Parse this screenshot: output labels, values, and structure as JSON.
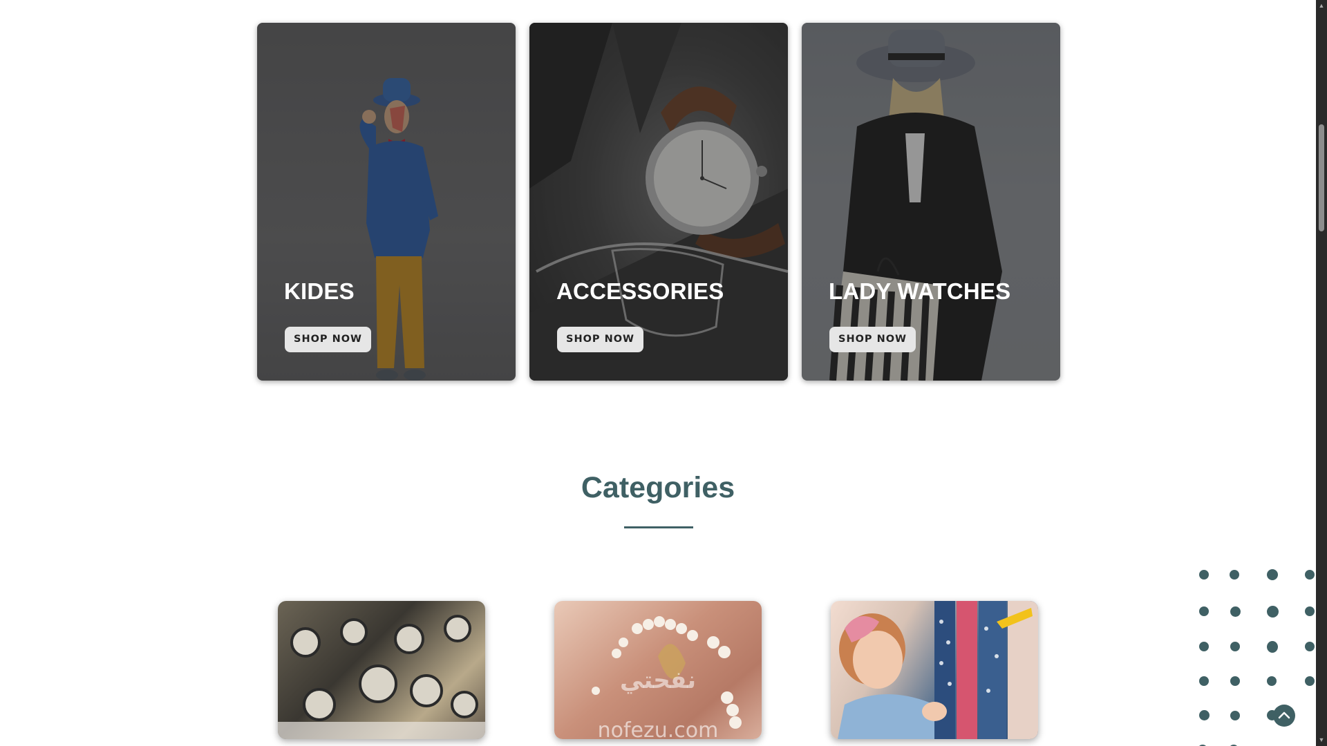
{
  "promo_cards": [
    {
      "title": "KIDES",
      "button": "SHOP NOW"
    },
    {
      "title": "ACCESSORIES",
      "button": "SHOP NOW"
    },
    {
      "title": "LADY WATCHES",
      "button": "SHOP NOW"
    }
  ],
  "categories_section": {
    "title": "Categories",
    "tiles": [
      {
        "image": "watches-display"
      },
      {
        "image": "pearl-jewelry",
        "watermark": "نفحتي",
        "watermark_sub": "nofezu.com"
      },
      {
        "image": "girl-with-clothes-rack"
      }
    ]
  },
  "icons": {
    "back_to_top": "chevron-up-icon",
    "scroll_up": "triangle-up-icon",
    "scroll_down": "triangle-down-icon"
  },
  "colors": {
    "accent": "#3f6064",
    "button_bg": "#e6e6e6"
  }
}
